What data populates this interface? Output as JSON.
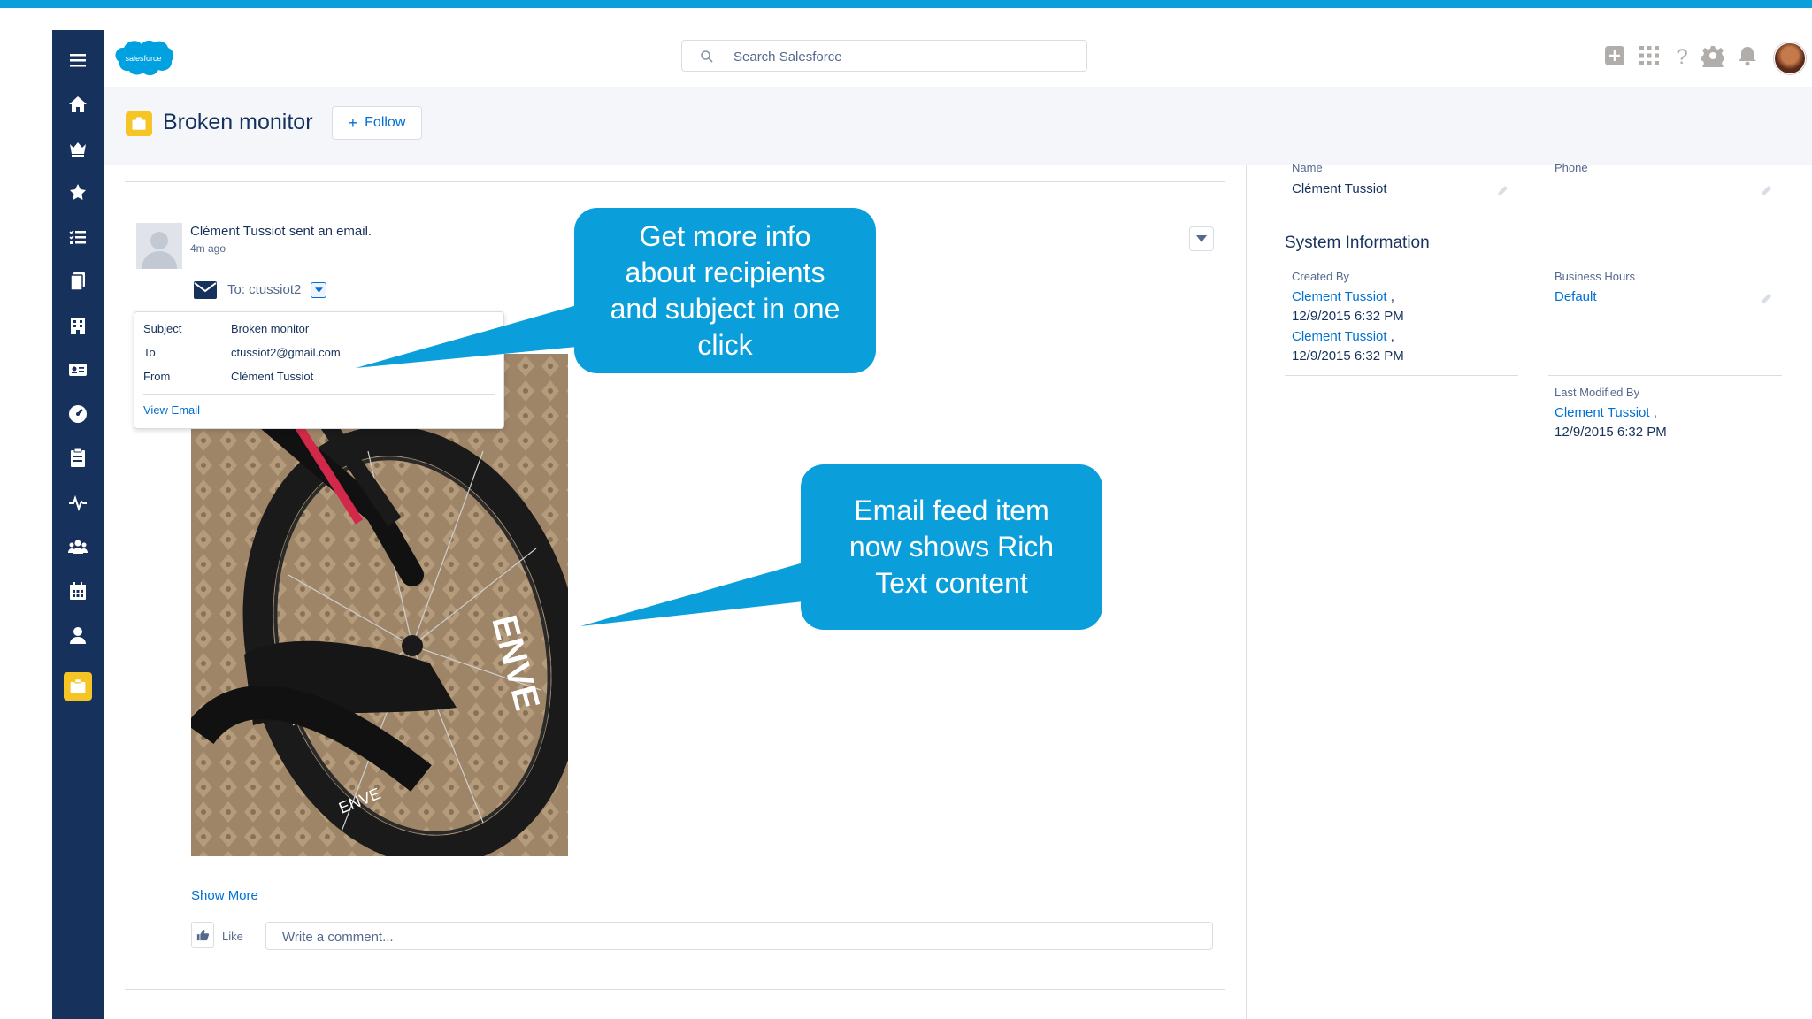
{
  "app": {
    "brand_logo_text": "salesforce",
    "search_placeholder": "Search Salesforce",
    "accent_color": "#0a9fdb",
    "nav_color": "#16325c"
  },
  "sidebar": {
    "items": [
      {
        "icon": "menu-icon"
      },
      {
        "icon": "home-icon"
      },
      {
        "icon": "opportunities-icon"
      },
      {
        "icon": "leads-icon"
      },
      {
        "icon": "tasks-icon"
      },
      {
        "icon": "files-icon"
      },
      {
        "icon": "accounts-icon"
      },
      {
        "icon": "contacts-icon"
      },
      {
        "icon": "dashboards-icon"
      },
      {
        "icon": "reports-icon"
      },
      {
        "icon": "feed-icon"
      },
      {
        "icon": "groups-icon"
      },
      {
        "icon": "calendar-icon"
      },
      {
        "icon": "people-icon"
      },
      {
        "icon": "cases-icon",
        "active": true
      }
    ]
  },
  "header_icons": [
    "add-icon",
    "app-launcher-icon",
    "help-icon",
    "setup-gear-icon",
    "notifications-bell-icon",
    "user-avatar"
  ],
  "record": {
    "title": "Broken monitor",
    "follow_label": "Follow"
  },
  "feed": {
    "actor_line": "Clément Tussiot sent an email.",
    "time_ago": "4m ago",
    "to_line": "To: ctussiot2",
    "popover": {
      "subject_label": "Subject",
      "subject_value": "Broken monitor",
      "to_label": "To",
      "to_value": "ctussiot2@gmail.com",
      "from_label": "From",
      "from_value": "Clément Tussiot",
      "view_email": "View Email"
    },
    "show_more": "Show More",
    "like_label": "Like",
    "comment_placeholder": "Write a comment..."
  },
  "details": {
    "name_label": "Name",
    "name_value": "Clément Tussiot",
    "phone_label": "Phone",
    "phone_value": "",
    "system_info_title": "System Information",
    "created_by_label": "Created By",
    "created_by": [
      {
        "user": "Clement Tussiot",
        "sep": ",",
        "date": "12/9/2015 6:32 PM"
      },
      {
        "user": "Clement Tussiot",
        "sep": ",",
        "date": "12/9/2015 6:32 PM"
      }
    ],
    "business_hours_label": "Business Hours",
    "business_hours_value": "Default",
    "last_modified_label": "Last Modified By",
    "last_modified_user": "Clement Tussiot",
    "last_modified_sep": ",",
    "last_modified_date": "12/9/2015 6:32 PM"
  },
  "callouts": {
    "recipients": [
      "Get more info",
      "about recipients",
      "and subject in one",
      "click"
    ],
    "rich_text": [
      "Email feed item",
      "now shows Rich",
      "Text content"
    ]
  }
}
